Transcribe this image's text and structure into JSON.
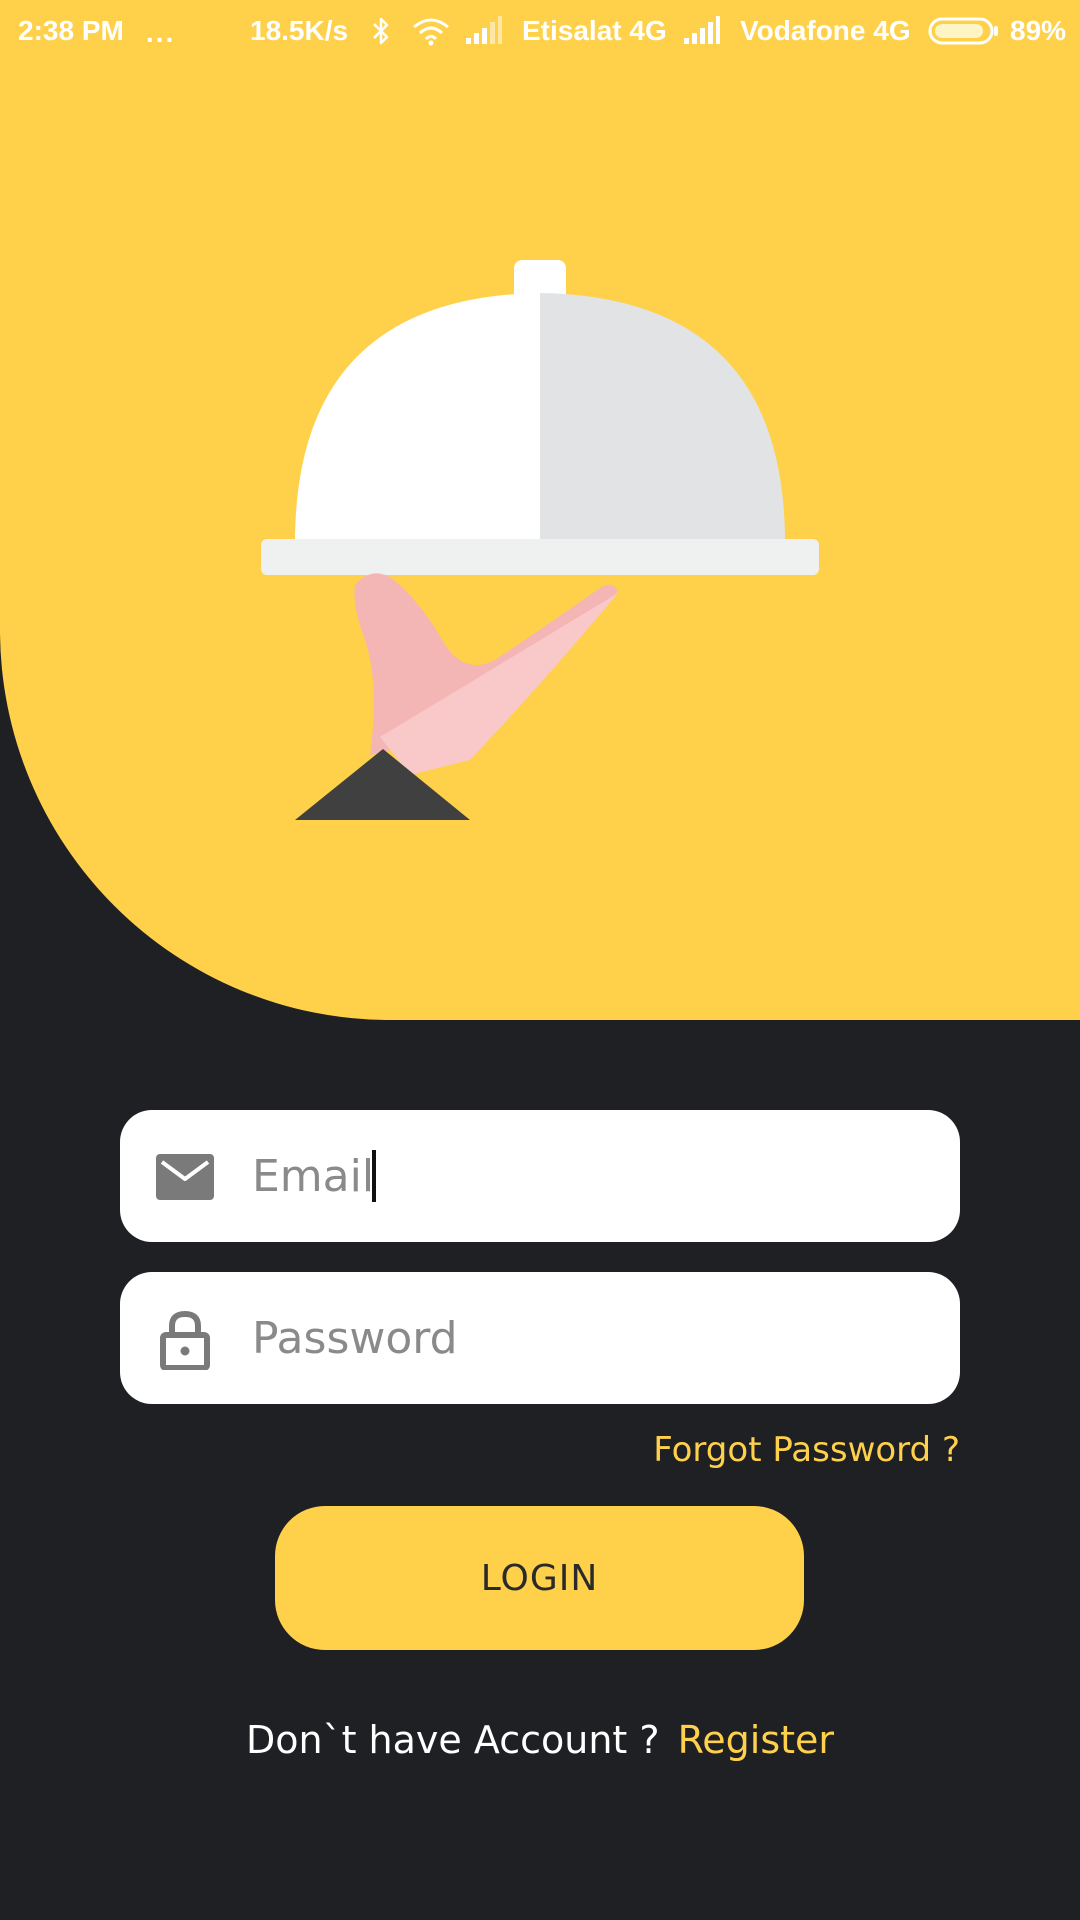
{
  "status_bar": {
    "time": "2:38 PM",
    "more_indicator": "...",
    "network_speed": "18.5K/s",
    "carrier_1": "Etisalat 4G",
    "carrier_2": "Vodafone 4G",
    "battery_percent": "89%",
    "battery_level": 0.89,
    "icons": [
      "bluetooth-icon",
      "wifi-icon",
      "signal-icon",
      "signal-icon",
      "battery-icon"
    ]
  },
  "hero": {
    "illustration": "serving-cloche-on-hand",
    "colors": {
      "background": "#ffd14a",
      "cloche_light": "#ffffff",
      "cloche_shade": "#e2e3e5",
      "tray": "#eff0f0",
      "hand": "#f4b5b5",
      "hand_light": "#f9c8c8",
      "sleeve": "#404040"
    }
  },
  "form": {
    "email": {
      "icon": "mail-icon",
      "placeholder": "Email",
      "value": ""
    },
    "password": {
      "icon": "lock-icon",
      "placeholder": "Password",
      "value": ""
    },
    "forgot_password_label": "Forgot Password ?",
    "login_label": "LOGIN",
    "register_prompt": "Don`t have Account ?",
    "register_label": "Register"
  },
  "theme": {
    "accent": "#ffd14a",
    "background": "#1f2024",
    "field_background": "#ffffff",
    "placeholder": "#8a8a8a"
  }
}
